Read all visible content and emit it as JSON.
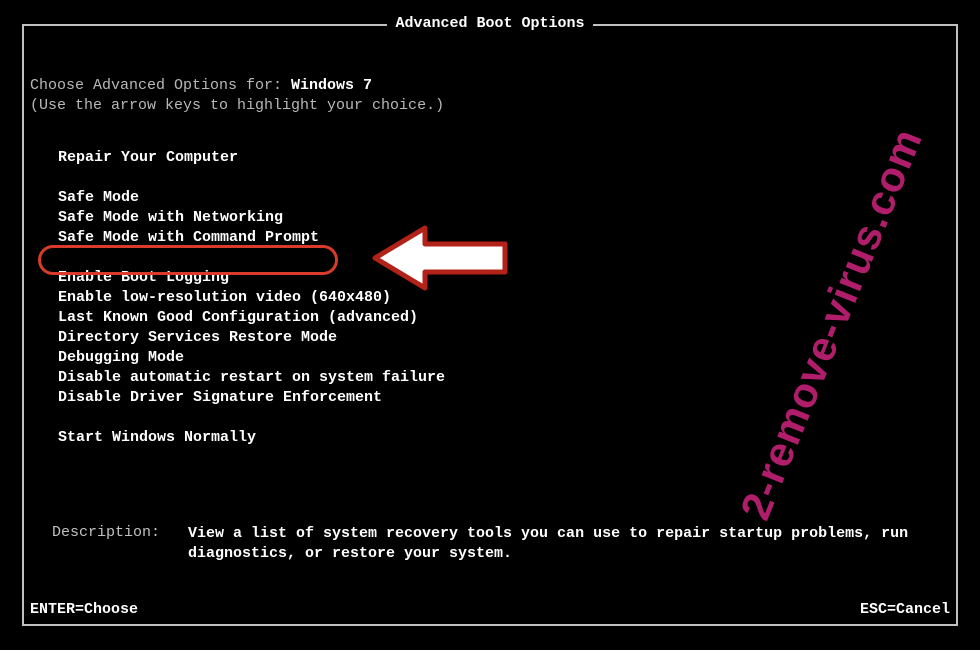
{
  "title": "Advanced Boot Options",
  "intro": {
    "prefix": "Choose Advanced Options for: ",
    "os": "Windows 7",
    "hint": "(Use the arrow keys to highlight your choice.)"
  },
  "groups": [
    {
      "items": [
        "Repair Your Computer"
      ]
    },
    {
      "items": [
        "Safe Mode",
        "Safe Mode with Networking",
        "Safe Mode with Command Prompt"
      ]
    },
    {
      "items": [
        "Enable Boot Logging",
        "Enable low-resolution video (640x480)",
        "Last Known Good Configuration (advanced)",
        "Directory Services Restore Mode",
        "Debugging Mode",
        "Disable automatic restart on system failure",
        "Disable Driver Signature Enforcement"
      ]
    },
    {
      "items": [
        "Start Windows Normally"
      ]
    }
  ],
  "highlighted_option": "Safe Mode with Command Prompt",
  "description": {
    "label": "Description:",
    "text": "View a list of system recovery tools you can use to repair startup problems, run diagnostics, or restore your system."
  },
  "footer": {
    "enter": "ENTER=Choose",
    "esc": "ESC=Cancel"
  },
  "watermark": "2-remove-virus.com",
  "annotation": {
    "arrow_color": "#ffffff",
    "arrow_stroke": "#b22218",
    "oval_color": "#d93a2b"
  }
}
